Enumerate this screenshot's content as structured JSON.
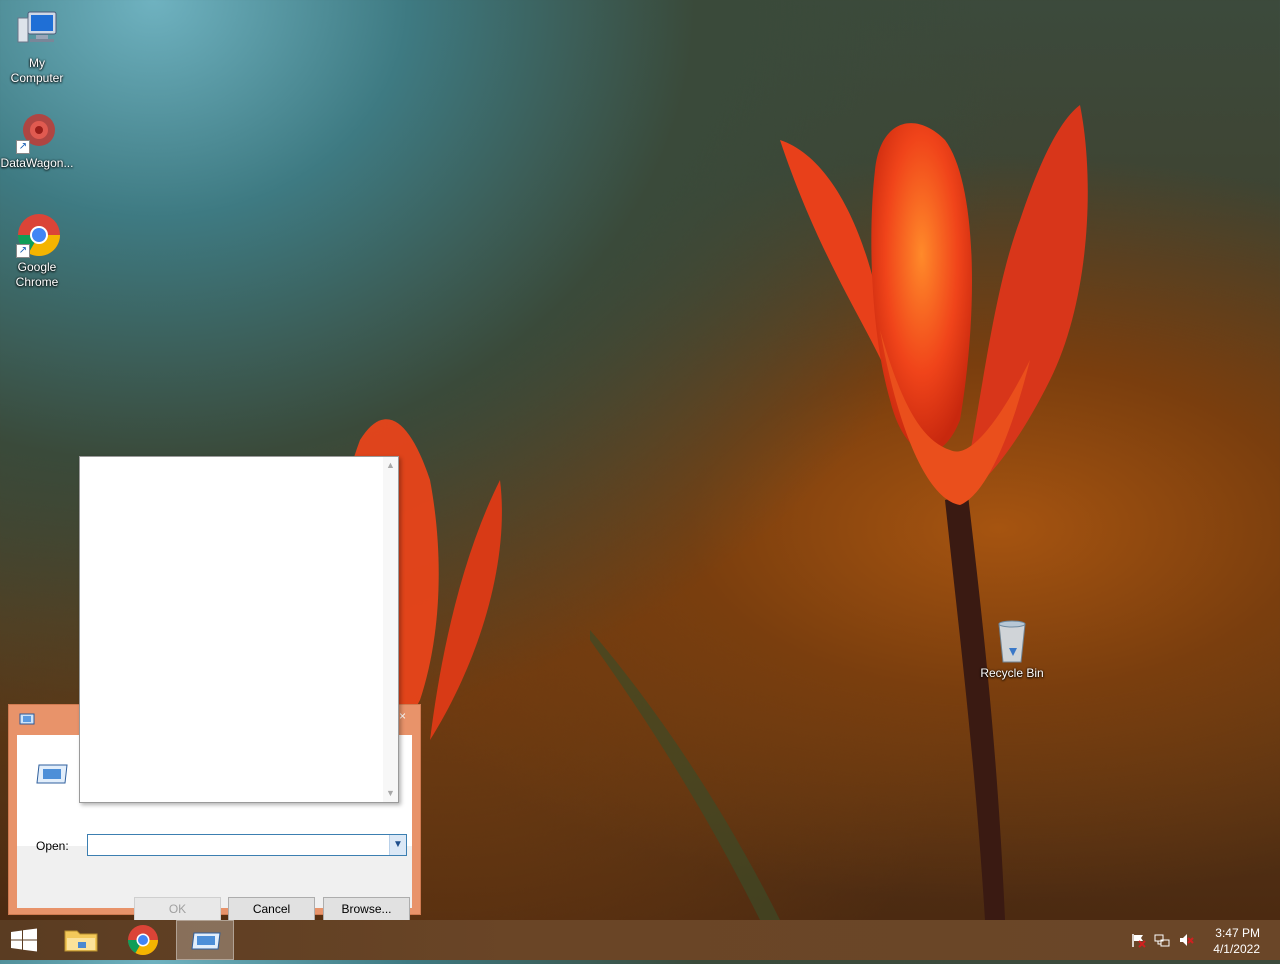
{
  "desktop": {
    "icons": [
      {
        "label_line1": "My",
        "label_line2": "Computer",
        "icon": "computer-icon"
      },
      {
        "label_line1": "DataWagon...",
        "label_line2": "",
        "icon": "datawagon-icon"
      },
      {
        "label_line1": "Google",
        "label_line2": "Chrome",
        "icon": "chrome-icon"
      },
      {
        "label_line1": "Recycle Bin",
        "label_line2": "",
        "icon": "recycle-bin-icon"
      }
    ]
  },
  "run_dialog": {
    "open_label": "Open:",
    "open_value": "",
    "ok_label": "OK",
    "cancel_label": "Cancel",
    "browse_label": "Browse...",
    "close_glyph": "×",
    "accent_color": "#e8936a"
  },
  "taskbar": {
    "items": [
      "start-button",
      "file-explorer",
      "google-chrome",
      "run"
    ],
    "active_item": "run",
    "clock": {
      "time": "3:47 PM",
      "date": "4/1/2022"
    },
    "tray_icons": [
      "action-center-flag-icon",
      "network-icon",
      "volume-muted-icon"
    ]
  }
}
